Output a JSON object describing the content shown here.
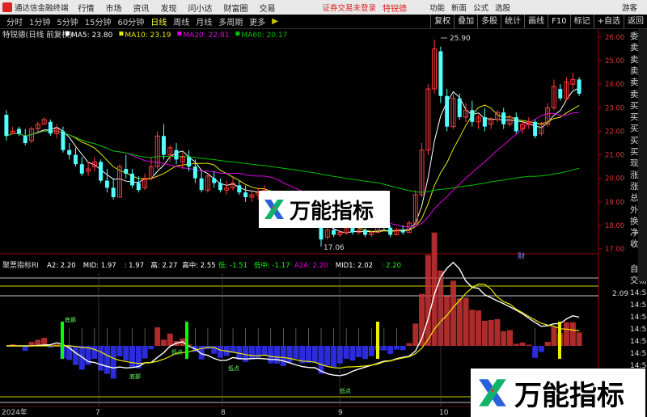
{
  "topbar": {
    "app_title": "通达信金融终端",
    "menu": [
      "行情",
      "市场",
      "资讯",
      "发现",
      "问小达",
      "财富圈",
      "交易"
    ],
    "login_status": "证券交易未登录",
    "stock_pool": "特锐德",
    "right_menu": [
      "功能",
      "新面",
      "公式",
      "选股"
    ],
    "guest": "游客"
  },
  "tabbar": {
    "periods": [
      "分时",
      "1分钟",
      "5分钟",
      "15分钟",
      "60分钟",
      "日线",
      "周线",
      "月线",
      "多周期",
      "更多"
    ],
    "active_index": 5,
    "arrows": "▶",
    "tools": [
      "复权",
      "叠加",
      "多股",
      "统计",
      "画线",
      "F10",
      "标记",
      "+自选",
      "返回"
    ]
  },
  "main_chart": {
    "stock_label": "特锐德(日线 前复权)",
    "ma": [
      {
        "label": "MA5:",
        "value": "23.80",
        "color": "#ffffff"
      },
      {
        "label": "MA10:",
        "value": "23.19",
        "color": "#e8e800"
      },
      {
        "label": "MA20:",
        "value": "22.81",
        "color": "#e000e0"
      },
      {
        "label": "MA60:",
        "value": "20.17",
        "color": "#00c000"
      }
    ],
    "high_label": "25.90",
    "low_label": "17.06",
    "marker_fin": "财",
    "y_ticks": [
      "26.00",
      "25.00",
      "24.00",
      "23.00",
      "22.00",
      "21.00",
      "20.00",
      "19.00",
      "18.00",
      "17.00"
    ],
    "y_corner": "R\n50",
    "right_labels": [
      "委比",
      "卖五",
      "卖四",
      "卖三",
      "卖二",
      "卖一",
      "买一",
      "买二",
      "买三",
      "买四",
      "买五",
      "现价",
      "涨跌",
      "涨幅",
      "总量",
      "外盘",
      "换手",
      "净资",
      "收益"
    ]
  },
  "sub_chart": {
    "name": "聚票指标RI",
    "params": [
      {
        "label": "A2:",
        "value": "2.20",
        "color": "#ffffff"
      },
      {
        "label": "MID:",
        "value": "1.97",
        "color": "#ffffff"
      },
      {
        "label": ":",
        "value": "1.97",
        "color": "#ffffff"
      },
      {
        "label": "高:",
        "value": "2.27",
        "color": "#ffffff"
      },
      {
        "label": "高中:",
        "value": "2.55",
        "color": "#ffffff"
      },
      {
        "label": "低:",
        "value": "-1.51",
        "color": "#00ff00"
      },
      {
        "label": "低中:",
        "value": "-1.17",
        "color": "#00ff00"
      },
      {
        "label": "A2A:",
        "value": "2.20",
        "color": "#e000e0"
      },
      {
        "label": "MID1:",
        "value": "2.02",
        "color": "#ffffff"
      },
      {
        "label": ":",
        "value": "2.20",
        "color": "#00ff00"
      }
    ],
    "y_tick": "2.09",
    "labels": [
      "底部",
      "底部",
      "低点",
      "低点",
      "低点"
    ],
    "right_labels": [
      "自动",
      "交易"
    ],
    "time_labels": [
      "14:58",
      "14:58",
      "14:58",
      "14:58",
      "14:58",
      "14:58",
      "14:58"
    ]
  },
  "x_axis": {
    "labels": [
      "2024年",
      "7",
      "8",
      "9",
      "10",
      "11"
    ]
  },
  "watermark": {
    "text": "万能指标",
    "logo": "stylized-x-logo"
  },
  "chart_data": {
    "type": "candlestick",
    "title": "特锐德(日线 前复权)",
    "x_months": [
      "7",
      "8",
      "9",
      "10",
      "11"
    ],
    "ylim": [
      17,
      26
    ],
    "y_ticks": [
      17,
      18,
      19,
      20,
      21,
      22,
      23,
      24,
      25,
      26
    ],
    "candles": [
      [
        22.7,
        22.9,
        21.8,
        21.6
      ],
      [
        21.9,
        22.2,
        22.0,
        21.9
      ],
      [
        22.1,
        22.2,
        21.9,
        21.8
      ],
      [
        21.8,
        22.1,
        21.5,
        21.4
      ],
      [
        21.6,
        22.2,
        22.1,
        21.5
      ],
      [
        22.1,
        22.4,
        22.3,
        21.9
      ],
      [
        22.3,
        22.6,
        22.5,
        22.3
      ],
      [
        22.4,
        22.5,
        21.9,
        21.8
      ],
      [
        21.9,
        22.3,
        22.1,
        21.7
      ],
      [
        22.0,
        22.2,
        21.2,
        21.1
      ],
      [
        21.2,
        21.5,
        21.0,
        20.8
      ],
      [
        21.0,
        21.3,
        20.6,
        20.5
      ],
      [
        20.6,
        20.9,
        20.2,
        20.1
      ],
      [
        20.3,
        20.7,
        20.4,
        20.1
      ],
      [
        20.5,
        20.9,
        20.7,
        20.3
      ],
      [
        20.7,
        20.8,
        19.9,
        19.8
      ],
      [
        19.9,
        20.4,
        19.6,
        19.4
      ],
      [
        19.6,
        20.0,
        19.2,
        19.1
      ],
      [
        19.2,
        20.6,
        20.5,
        19.2
      ],
      [
        20.4,
        21.0,
        20.2,
        20.0
      ],
      [
        20.2,
        20.4,
        19.7,
        19.6
      ],
      [
        19.8,
        20.1,
        19.5,
        19.4
      ],
      [
        19.6,
        20.2,
        20.0,
        19.5
      ],
      [
        20.0,
        20.9,
        20.5,
        19.9
      ],
      [
        20.5,
        22.0,
        21.8,
        20.4
      ],
      [
        21.8,
        22.3,
        21.0,
        20.8
      ],
      [
        21.0,
        21.4,
        21.3,
        20.7
      ],
      [
        21.2,
        21.5,
        20.8,
        20.6
      ],
      [
        20.7,
        21.1,
        20.9,
        20.4
      ],
      [
        20.9,
        21.2,
        20.5,
        20.3
      ],
      [
        20.5,
        20.8,
        20.0,
        19.8
      ],
      [
        20.0,
        20.3,
        19.5,
        19.4
      ],
      [
        19.5,
        20.2,
        20.1,
        19.4
      ],
      [
        20.0,
        20.3,
        19.8,
        19.6
      ],
      [
        19.8,
        20.0,
        19.5,
        19.4
      ],
      [
        19.5,
        19.9,
        19.6,
        19.3
      ],
      [
        19.6,
        20.1,
        19.8,
        19.5
      ],
      [
        19.7,
        19.9,
        19.4,
        19.3
      ],
      [
        19.4,
        19.7,
        19.2,
        19.0
      ],
      [
        19.2,
        19.5,
        19.3,
        19.0
      ],
      [
        19.3,
        19.6,
        19.4,
        19.1
      ],
      [
        19.4,
        19.7,
        19.5,
        19.2
      ],
      [
        19.4,
        19.5,
        19.0,
        18.9
      ],
      [
        19.0,
        19.3,
        18.9,
        18.7
      ],
      [
        18.9,
        19.1,
        18.6,
        18.5
      ],
      [
        18.6,
        18.9,
        18.7,
        18.5
      ],
      [
        18.7,
        19.0,
        18.8,
        18.6
      ],
      [
        18.8,
        18.9,
        18.4,
        18.2
      ],
      [
        18.4,
        18.6,
        18.3,
        18.1
      ],
      [
        18.3,
        18.5,
        18.2,
        18.0
      ],
      [
        18.2,
        18.4,
        17.4,
        17.1
      ],
      [
        17.5,
        17.9,
        17.8,
        17.4
      ],
      [
        17.8,
        18.0,
        17.6,
        17.5
      ],
      [
        17.6,
        17.8,
        17.7,
        17.5
      ],
      [
        17.7,
        18.0,
        17.9,
        17.6
      ],
      [
        17.9,
        18.1,
        17.7,
        17.6
      ],
      [
        17.7,
        17.9,
        17.8,
        17.6
      ],
      [
        17.8,
        18.0,
        17.6,
        17.5
      ],
      [
        17.6,
        17.8,
        17.7,
        17.5
      ],
      [
        17.7,
        18.1,
        18.0,
        17.7
      ],
      [
        18.0,
        18.2,
        17.9,
        17.8
      ],
      [
        17.9,
        18.0,
        17.6,
        17.5
      ],
      [
        17.6,
        17.9,
        17.8,
        17.6
      ],
      [
        17.8,
        18.0,
        17.7,
        17.6
      ],
      [
        17.7,
        18.2,
        18.1,
        17.7
      ],
      [
        18.1,
        19.5,
        19.3,
        18.0
      ],
      [
        19.3,
        21.5,
        21.2,
        19.2
      ],
      [
        21.2,
        24.0,
        23.8,
        21.0
      ],
      [
        23.8,
        25.9,
        25.5,
        23.6
      ],
      [
        25.4,
        25.6,
        23.5,
        23.2
      ],
      [
        23.5,
        23.8,
        22.2,
        22.0
      ],
      [
        22.2,
        23.6,
        23.4,
        22.1
      ],
      [
        23.4,
        23.6,
        22.6,
        22.5
      ],
      [
        22.6,
        23.2,
        22.9,
        22.4
      ],
      [
        22.9,
        23.3,
        22.4,
        22.2
      ],
      [
        22.4,
        22.7,
        22.6,
        22.1
      ],
      [
        22.6,
        23.0,
        22.2,
        22.0
      ],
      [
        22.3,
        22.6,
        22.5,
        22.1
      ],
      [
        22.5,
        22.9,
        22.8,
        22.4
      ],
      [
        22.8,
        23.0,
        22.3,
        22.1
      ],
      [
        22.3,
        22.7,
        22.6,
        22.2
      ],
      [
        22.6,
        22.8,
        22.0,
        21.9
      ],
      [
        22.1,
        22.4,
        22.3,
        21.9
      ],
      [
        22.3,
        22.6,
        22.4,
        22.1
      ],
      [
        22.4,
        22.5,
        21.8,
        21.7
      ],
      [
        21.9,
        22.4,
        22.3,
        21.8
      ],
      [
        22.3,
        23.2,
        23.0,
        22.2
      ],
      [
        23.0,
        24.2,
        23.9,
        22.9
      ],
      [
        23.8,
        24.0,
        23.4,
        23.3
      ],
      [
        23.4,
        24.3,
        24.1,
        23.3
      ],
      [
        24.0,
        24.5,
        24.2,
        23.8
      ],
      [
        24.2,
        24.3,
        23.6,
        23.5
      ]
    ],
    "series": [
      {
        "name": "MA5",
        "value": 23.8
      },
      {
        "name": "MA10",
        "value": 23.19
      },
      {
        "name": "MA20",
        "value": 22.81
      },
      {
        "name": "MA60",
        "value": 20.17
      }
    ],
    "annotations": [
      "25.90",
      "17.06"
    ]
  }
}
